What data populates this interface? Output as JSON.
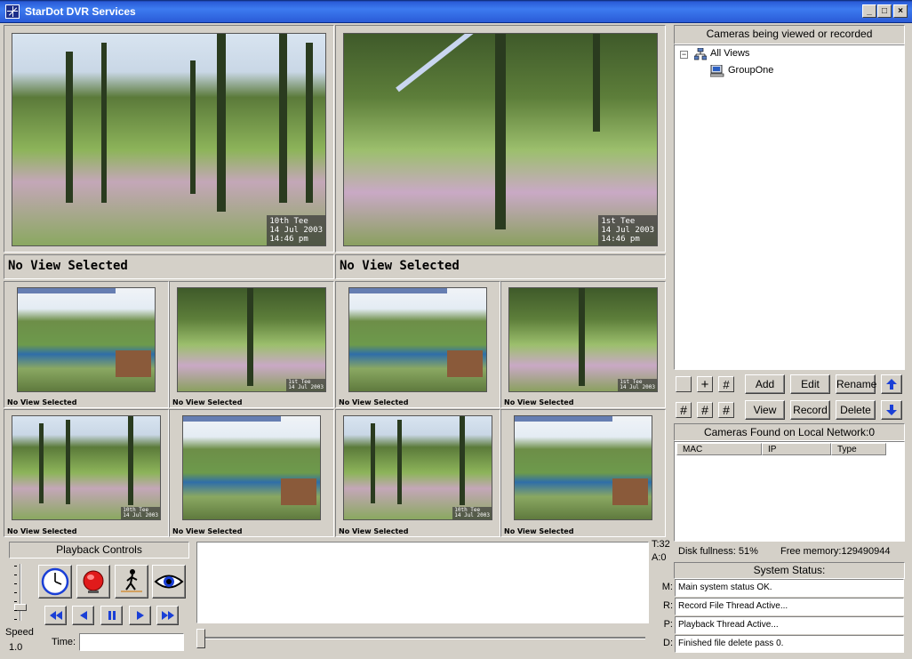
{
  "window": {
    "title": "StarDot DVR Services",
    "controls": {
      "minimize": "_",
      "maximize": "□",
      "close": "×"
    }
  },
  "views": {
    "large": [
      {
        "caption": "No View Selected",
        "stamp": "10th Tee\n14 Jul 2003\n14:46 pm"
      },
      {
        "caption": "No View Selected",
        "stamp": "1st Tee\n14 Jul 2003\n14:46 pm"
      }
    ],
    "small_caption": "No View Selected"
  },
  "right_panel": {
    "cameras_header": "Cameras being viewed or recorded",
    "tree": {
      "root": "All Views",
      "child": "GroupOne"
    },
    "buttons": {
      "add": "Add",
      "edit": "Edit",
      "rename": "Rename",
      "view": "View",
      "record": "Record",
      "delete": "Delete"
    },
    "network_header": "Cameras Found on Local Network:0",
    "network_columns": [
      "MAC",
      "IP",
      "Type"
    ],
    "disk_fullness": "Disk fullness: 51%",
    "free_memory": "Free memory:129490944",
    "system_status_header": "System Status:",
    "status_rows": [
      {
        "label": "M:",
        "value": "Main system status OK."
      },
      {
        "label": "R:",
        "value": "Record File Thread Active..."
      },
      {
        "label": "P:",
        "value": "Playback Thread Active..."
      },
      {
        "label": "D:",
        "value": "Finished file delete pass 0."
      }
    ]
  },
  "playback": {
    "header": "Playback Controls",
    "speed_label": "Speed",
    "speed_value": "1.0",
    "time_label": "Time:",
    "time_value": "",
    "t_counter": "T:32",
    "a_counter": "A:0"
  }
}
